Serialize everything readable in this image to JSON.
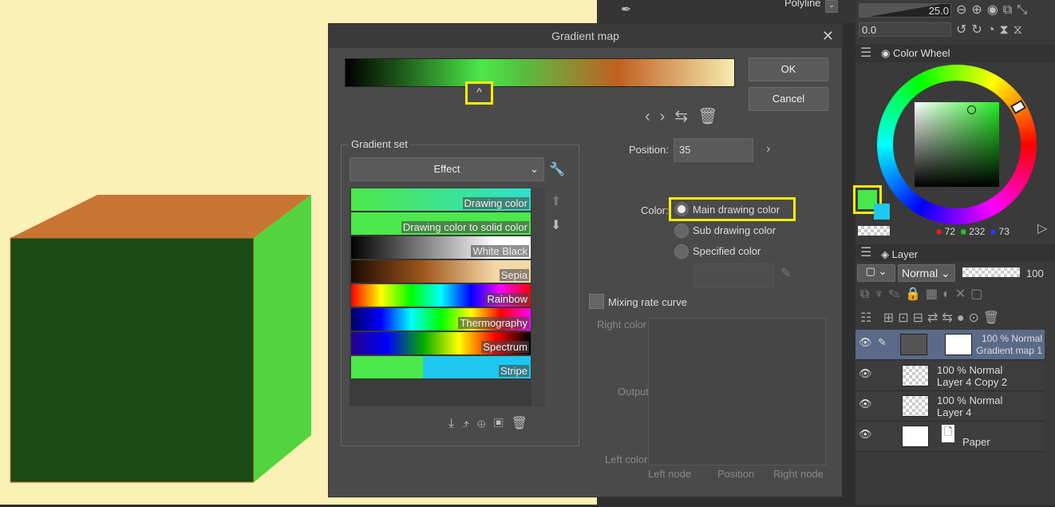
{
  "app": {
    "top_tool_label": "Polyline",
    "brush_size": "25.0",
    "brush_opacity": "0.0"
  },
  "dialog": {
    "title": "Gradient map",
    "ok": "OK",
    "cancel": "Cancel",
    "gradient_set_label": "Gradient set",
    "gradient_set_value": "Effect",
    "gradients": [
      "Drawing color",
      "Drawing color to solid color",
      "White Black",
      "Sepia",
      "Rainbow",
      "Thermography",
      "Spectrum",
      "Stripe"
    ],
    "position_label": "Position:",
    "position_value": "35",
    "color_label": "Color:",
    "color_options": [
      "Main drawing color",
      "Sub drawing color",
      "Specified color"
    ],
    "mixing_label": "Mixing rate curve",
    "right_color": "Right color",
    "output": "Output",
    "left_color": "Left color",
    "left_node": "Left node",
    "position_axis": "Position",
    "right_node": "Right node"
  },
  "color_panel": {
    "tab": "Color Wheel",
    "r": "72",
    "g": "232",
    "b": "73",
    "main_color": "#48e849",
    "sub_color": "#1ec8f0"
  },
  "layer_panel": {
    "tab": "Layer",
    "blend_mode": "Normal",
    "opacity": "100",
    "layers": [
      {
        "line1": "100 % Normal",
        "line2": "Gradient map 1"
      },
      {
        "line1": "100 % Normal",
        "line2": "Layer 4 Copy 2"
      },
      {
        "line1": "100 % Normal",
        "line2": "Layer 4"
      },
      {
        "line1": "",
        "line2": "Paper"
      }
    ]
  }
}
